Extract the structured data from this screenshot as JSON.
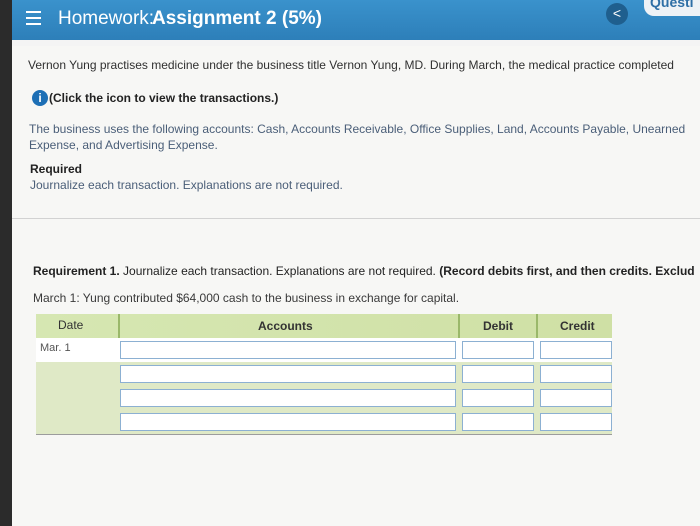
{
  "header": {
    "label": "Homework:",
    "title": "Assignment 2 (5%)",
    "back_label": "<",
    "question_tab": "Questi"
  },
  "problem": {
    "intro": "Vernon Yung practises medicine under the business title Vernon Yung, MD. During March, the medical practice completed",
    "info_link": "(Click the icon to view the transactions.)",
    "accounts_line1": "The business uses the following accounts: Cash, Accounts Receivable, Office Supplies, Land, Accounts Payable, Unearned",
    "accounts_line2": "Expense, and Advertising Expense.",
    "required_heading": "Required",
    "required_text": "Journalize each transaction. Explanations are not required."
  },
  "requirement": {
    "prefix": "Requirement 1.",
    "text": " Journalize each transaction. Explanations are not required.",
    "bold_text": " (Record debits first, and then credits. Exclud",
    "context": "March 1: Yung contributed $64,000 cash to the business in exchange for capital."
  },
  "journal": {
    "headers": {
      "date": "Date",
      "accounts": "Accounts",
      "debit": "Debit",
      "credit": "Credit"
    },
    "rows": [
      {
        "date": "Mar. 1",
        "account": "",
        "debit": "",
        "credit": ""
      },
      {
        "date": "",
        "account": "",
        "debit": "",
        "credit": ""
      },
      {
        "date": "",
        "account": "",
        "debit": "",
        "credit": ""
      },
      {
        "date": "",
        "account": "",
        "debit": "",
        "credit": ""
      }
    ]
  },
  "colors": {
    "header_bar": "#2d7fb9",
    "table_header": "#d6e7b2",
    "info_icon": "#1d6fb5"
  },
  "icons": {
    "menu": "menu-icon",
    "info": "info-icon",
    "back": "chevron-left-icon"
  }
}
